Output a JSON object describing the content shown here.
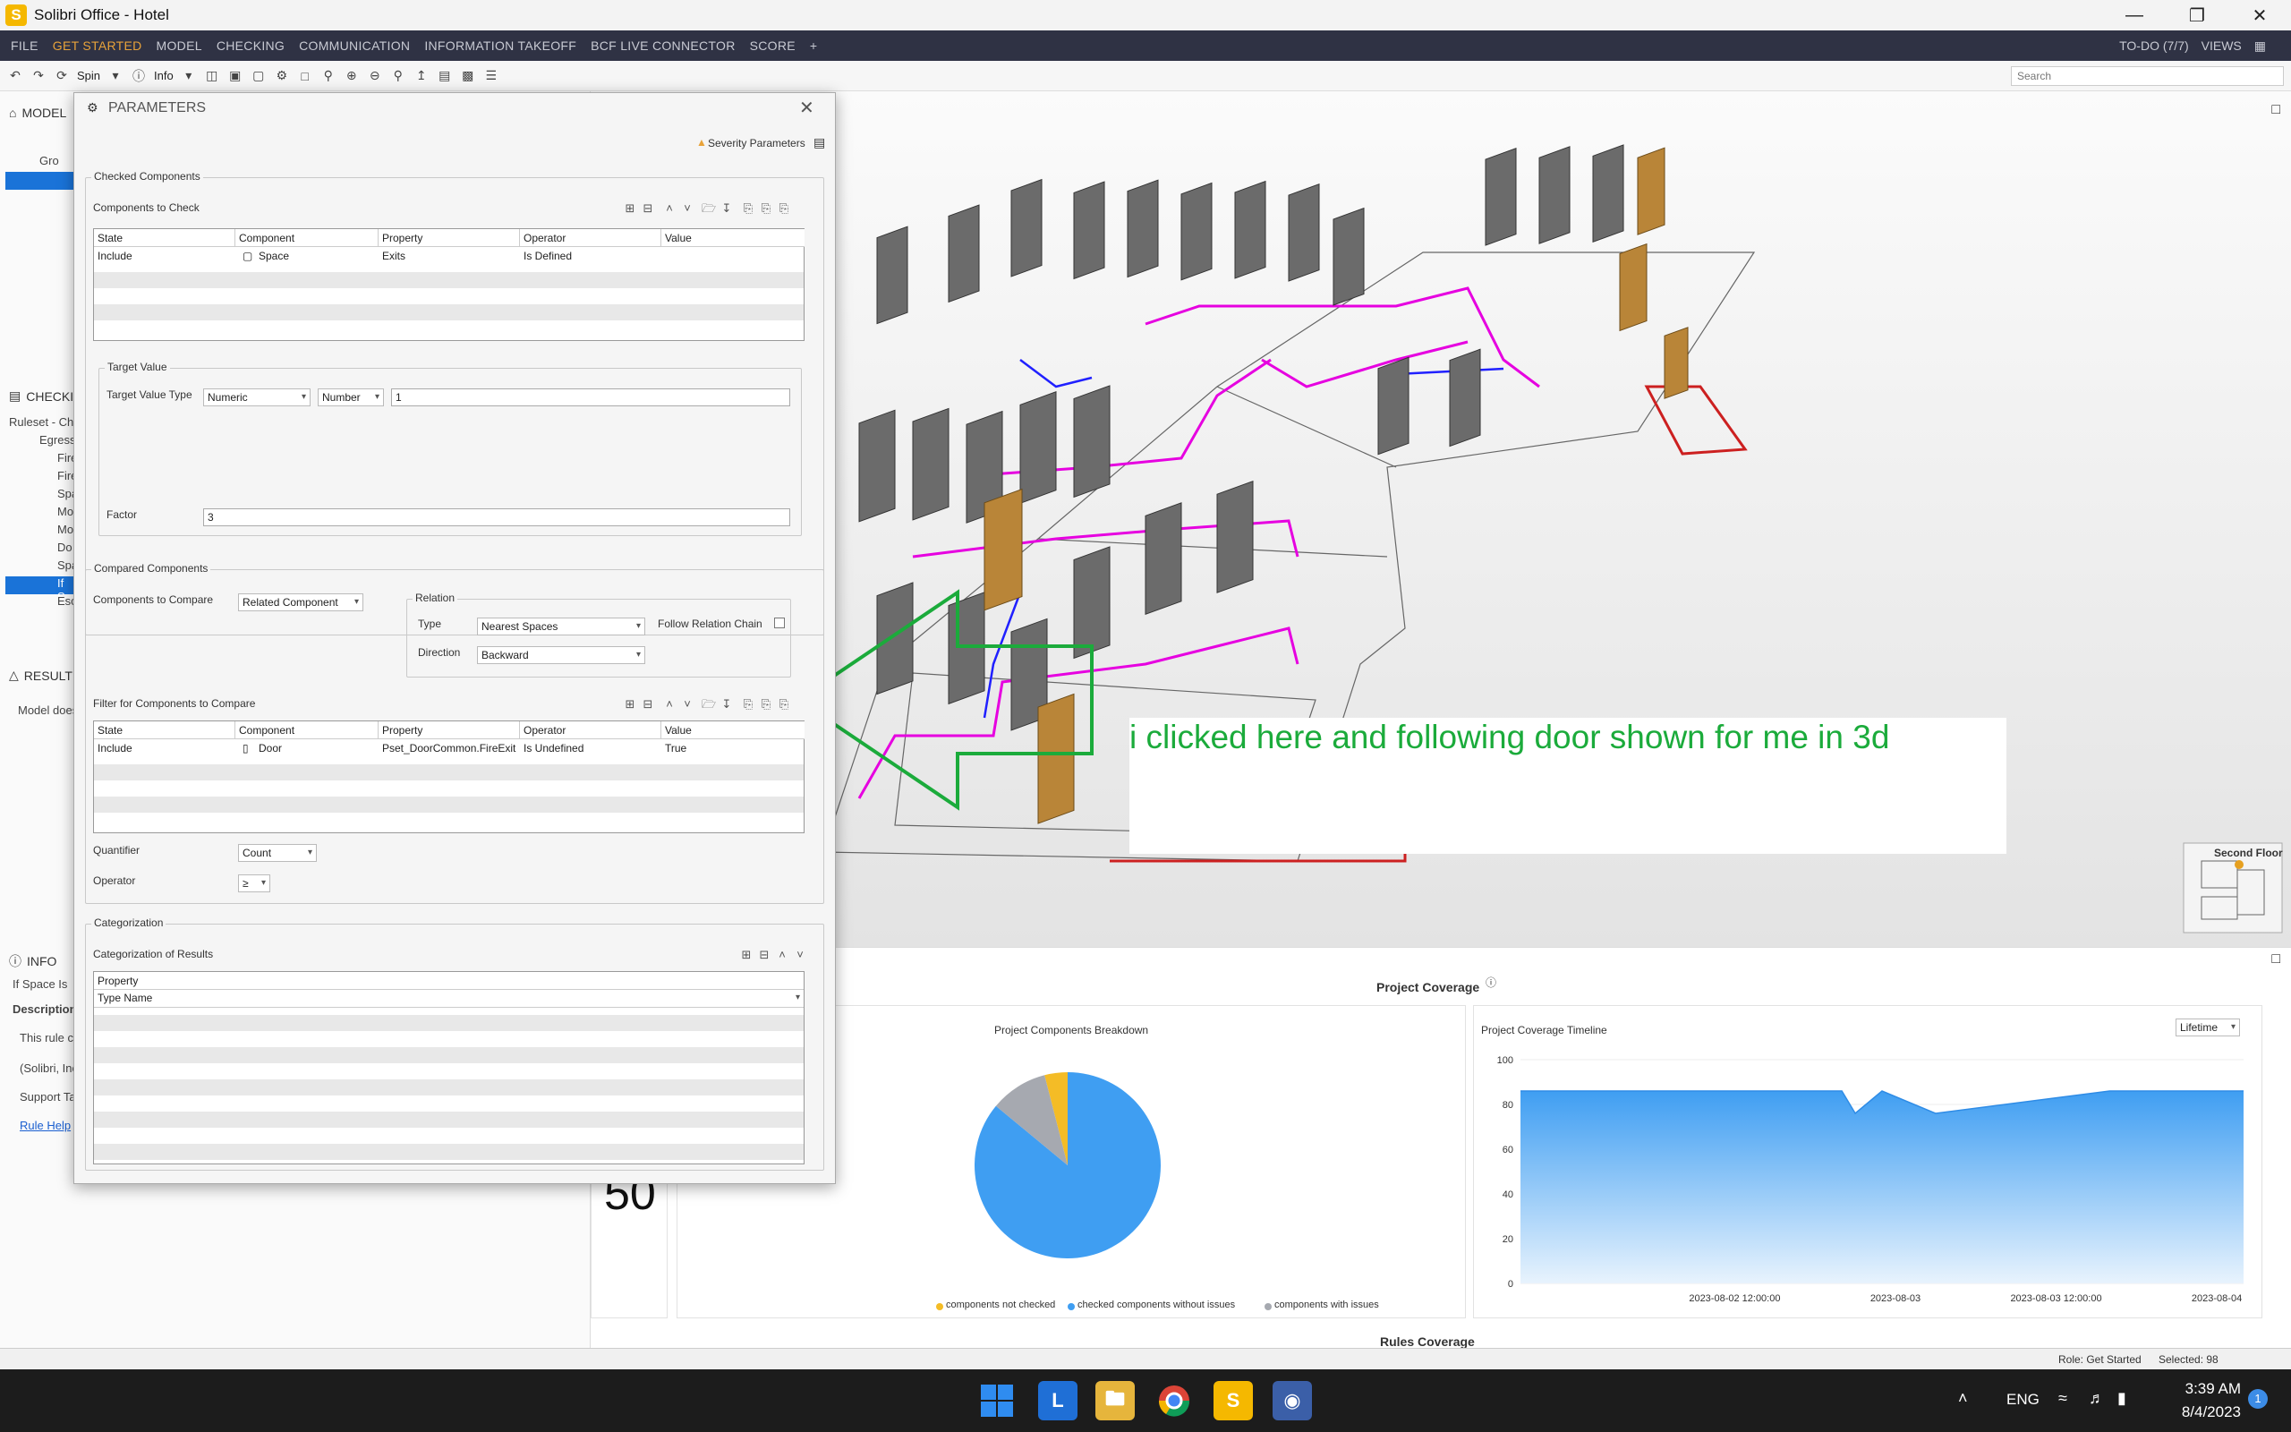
{
  "window": {
    "title": "Solibri Office - Hotel",
    "app_letter": "S"
  },
  "menu": {
    "items": [
      "FILE",
      "GET STARTED",
      "MODEL",
      "CHECKING",
      "COMMUNICATION",
      "INFORMATION TAKEOFF",
      "BCF LIVE CONNECTOR",
      "SCORE",
      "+"
    ],
    "active": "GET STARTED",
    "todo": "TO-DO (7/7)",
    "views": "VIEWS"
  },
  "toolbar": {
    "spin": "Spin",
    "info": "Info",
    "search_placeholder": "Search"
  },
  "left": {
    "model_header": "MODEL",
    "tree_labels": [
      "Gro"
    ],
    "checking_header": "CHECKI",
    "ruleset": "Ruleset - Che",
    "egress": "Egress",
    "rules": [
      "Fire",
      "Fire",
      "Spa",
      "Mo",
      "Mo",
      "Do",
      "Spa",
      "If S",
      "Esc"
    ],
    "results_header": "RESULT",
    "results_text": "Model does",
    "info_header": "INFO",
    "info_rule": "If Space Is",
    "description_label": "Description",
    "desc_lines": [
      "This rule ch",
      "(Solibri, Inc",
      "Support Ta"
    ],
    "rule_help": "Rule Help",
    "big_number": "50"
  },
  "dialog": {
    "title": "PARAMETERS",
    "severity": "Severity Parameters",
    "checked_components": "Checked Components",
    "components_to_check": "Components to Check",
    "table_headers": [
      "State",
      "Component",
      "Property",
      "Operator",
      "Value"
    ],
    "check_row": {
      "state": "Include",
      "component": "Space",
      "property": "Exits",
      "operator": "Is Defined",
      "value": ""
    },
    "target_value": "Target Value",
    "target_value_type_label": "Target Value Type",
    "target_value_type": "Numeric",
    "number_type": "Number",
    "target_value_input": "1",
    "factor_label": "Factor",
    "factor_value": "3",
    "compared_components": "Compared Components",
    "components_to_compare_label": "Components to Compare",
    "components_to_compare": "Related Component",
    "relation": "Relation",
    "type_label": "Type",
    "type_value": "Nearest Spaces",
    "follow_chain": "Follow Relation Chain",
    "direction_label": "Direction",
    "direction_value": "Backward",
    "filter_title": "Filter for Components to Compare",
    "filter_row": {
      "state": "Include",
      "component": "Door",
      "property": "Pset_DoorCommon.FireExit",
      "operator": "Is Undefined",
      "value": "True"
    },
    "quantifier_label": "Quantifier",
    "quantifier_value": "Count",
    "operator_label": "Operator",
    "operator_value": "≥",
    "categorization": "Categorization",
    "categorization_of_results": "Categorization of Results",
    "property_header": "Property",
    "property_value": "Type Name"
  },
  "annotation": {
    "text": "i clicked here and following door shown for me in 3d",
    "color": "#1bab3b"
  },
  "viewport": {
    "floor_label": "Second Floor"
  },
  "bottom": {
    "project_coverage": "Project Coverage",
    "breakdown_title": "Project Components Breakdown",
    "timeline_title": "Project Coverage Timeline",
    "lifetime": "Lifetime",
    "legend": [
      "components not checked",
      "checked components without issues",
      "components with issues"
    ],
    "rules_coverage": "Rules Coverage",
    "x_ticks": [
      "2023-08-02 12:00:00",
      "2023-08-03",
      "2023-08-03 12:00:00",
      "2023-08-04"
    ],
    "y_ticks": [
      "100",
      "80",
      "60",
      "40",
      "20",
      "0"
    ]
  },
  "chart_data": [
    {
      "type": "pie",
      "title": "Project Components Breakdown",
      "labels": [
        "components not checked",
        "checked components without issues",
        "components with issues"
      ],
      "values": [
        4,
        86,
        10
      ],
      "colors": [
        "#f4bc26",
        "#3f9ef2",
        "#a6a9b0"
      ]
    },
    {
      "type": "area",
      "title": "Project Coverage Timeline",
      "ylim": [
        0,
        100
      ],
      "x": [
        "2023-08-01 20:00",
        "2023-08-02 09:00",
        "2023-08-02 20:00",
        "2023-08-02 21:00",
        "2023-08-02 23:00",
        "2023-08-03 03:00",
        "2023-08-03 16:00",
        "2023-08-04 02:00"
      ],
      "y": [
        86,
        86,
        86,
        76,
        86,
        76,
        86,
        86
      ]
    }
  ],
  "status": {
    "role": "Role: Get Started",
    "selected": "Selected: 98"
  },
  "taskbar": {
    "lang": "ENG",
    "time": "3:39 AM",
    "date": "8/4/2023",
    "notif": "1"
  }
}
